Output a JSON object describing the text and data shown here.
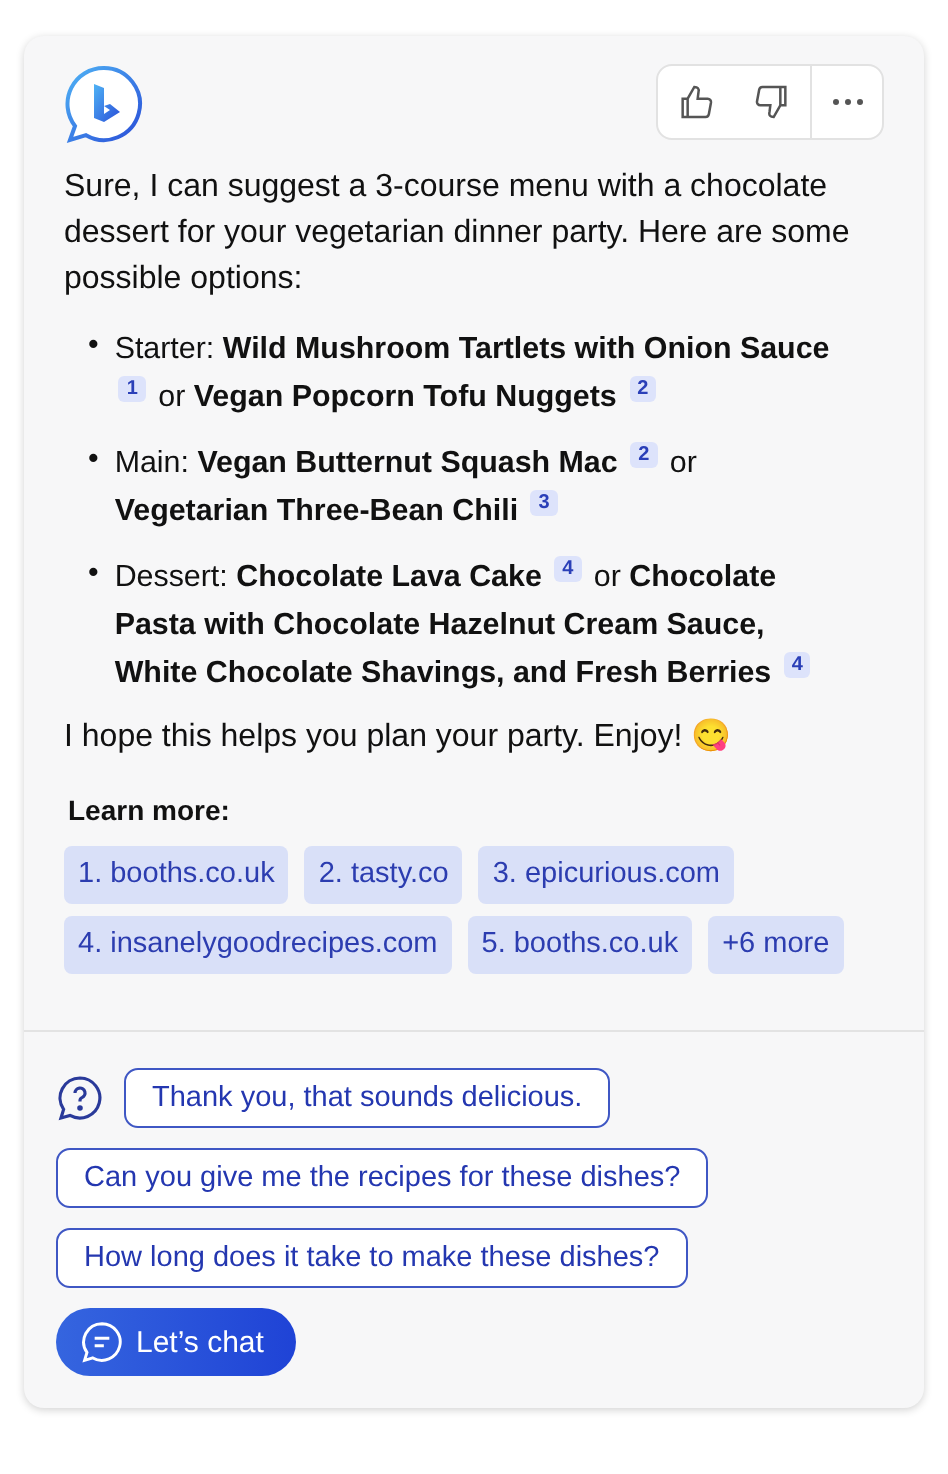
{
  "intro": "Sure, I can suggest a 3-course menu with a chocolate dessert for your vegetarian dinner party. Here are some possible options:",
  "items": [
    {
      "marker": "•",
      "parts": [
        {
          "kind": "text",
          "text": "Starter:"
        },
        {
          "kind": "bold",
          "text": "Wild Mushroom Tartlets with Onion Sauce"
        },
        {
          "kind": "cite",
          "text": "1"
        },
        {
          "kind": "text",
          "text": "or"
        },
        {
          "kind": "bold",
          "text": "Vegan Popcorn Tofu Nuggets"
        },
        {
          "kind": "cite",
          "text": "2"
        }
      ]
    },
    {
      "marker": "•",
      "parts": [
        {
          "kind": "text",
          "text": "Main:"
        },
        {
          "kind": "bold",
          "text": "Vegan Butternut Squash Mac"
        },
        {
          "kind": "cite",
          "text": "2"
        },
        {
          "kind": "text",
          "text": "or"
        },
        {
          "kind": "bold",
          "text": "Vegetarian Three-Bean Chili"
        },
        {
          "kind": "cite",
          "text": "3"
        }
      ]
    },
    {
      "marker": "•",
      "parts": [
        {
          "kind": "text",
          "text": "Dessert:"
        },
        {
          "kind": "bold",
          "text": "Chocolate Lava Cake"
        },
        {
          "kind": "cite",
          "text": "4"
        },
        {
          "kind": "text",
          "text": "or"
        },
        {
          "kind": "bold",
          "text": "Chocolate Pasta with Chocolate Hazelnut Cream Sauce, White Chocolate Shavings, and Fresh Berries"
        },
        {
          "kind": "cite",
          "text": "4"
        }
      ]
    }
  ],
  "closing": "I hope this helps you plan your party. Enjoy! 😋",
  "learn_more": {
    "title": "Learn more:",
    "links": [
      "1. booths.co.uk",
      "2. tasty.co",
      "3. epicurious.com",
      "4. insanelygoodrecipes.com",
      "5. booths.co.uk",
      "+6 more"
    ]
  },
  "suggestions": [
    "Thank you, that sounds delicious.",
    "Can you give me the recipes for these dishes?",
    "How long does it take to make these dishes?"
  ],
  "chat_button": "Let’s chat"
}
